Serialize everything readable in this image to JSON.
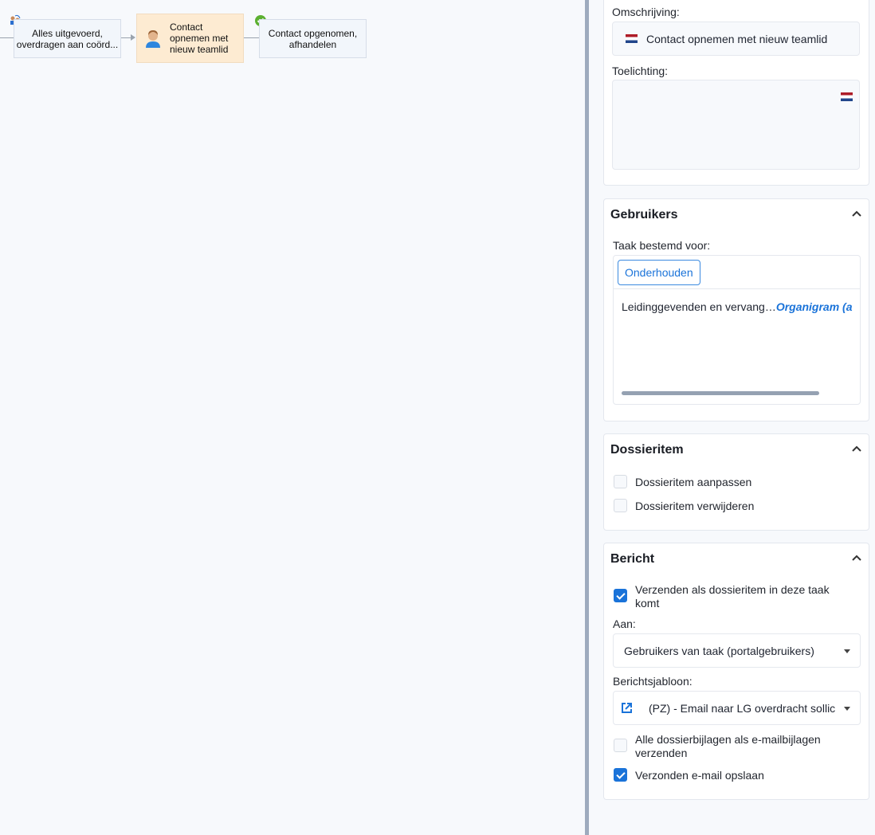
{
  "workflow": {
    "nodes": [
      {
        "label": "Alles uitgevoerd, overdragen aan coörd..."
      },
      {
        "label": "Contact opnemen met nieuw teamlid"
      },
      {
        "label": "Contact opgenomen, afhandelen"
      }
    ]
  },
  "details": {
    "omschrijving_label": "Omschrijving:",
    "omschrijving_value": "Contact opnemen met nieuw teamlid",
    "toelichting_label": "Toelichting:",
    "toelichting_value": ""
  },
  "gebruikers": {
    "title": "Gebruikers",
    "taak_label": "Taak bestemd voor:",
    "onderhouden_label": "Onderhouden",
    "row_text": "Leidinggevenden en vervang…",
    "row_link": "Organigram (a"
  },
  "dossieritem": {
    "title": "Dossieritem",
    "options": [
      {
        "label": "Dossieritem aanpassen",
        "checked": false
      },
      {
        "label": "Dossieritem verwijderen",
        "checked": false
      }
    ]
  },
  "bericht": {
    "title": "Bericht",
    "verzenden_label": "Verzenden als dossieritem in deze taak komt",
    "verzenden_checked": true,
    "aan_label": "Aan:",
    "aan_value": "Gebruikers van taak (portalgebruikers)",
    "sjabloon_label": "Berichtsjabloon:",
    "sjabloon_value": "(PZ) - Email naar LG overdracht sollic",
    "bijlagen_label": "Alle dossierbijlagen als e-mailbijlagen verzenden",
    "bijlagen_checked": false,
    "opslaan_label": "Verzonden e-mail opslaan",
    "opslaan_checked": true
  }
}
